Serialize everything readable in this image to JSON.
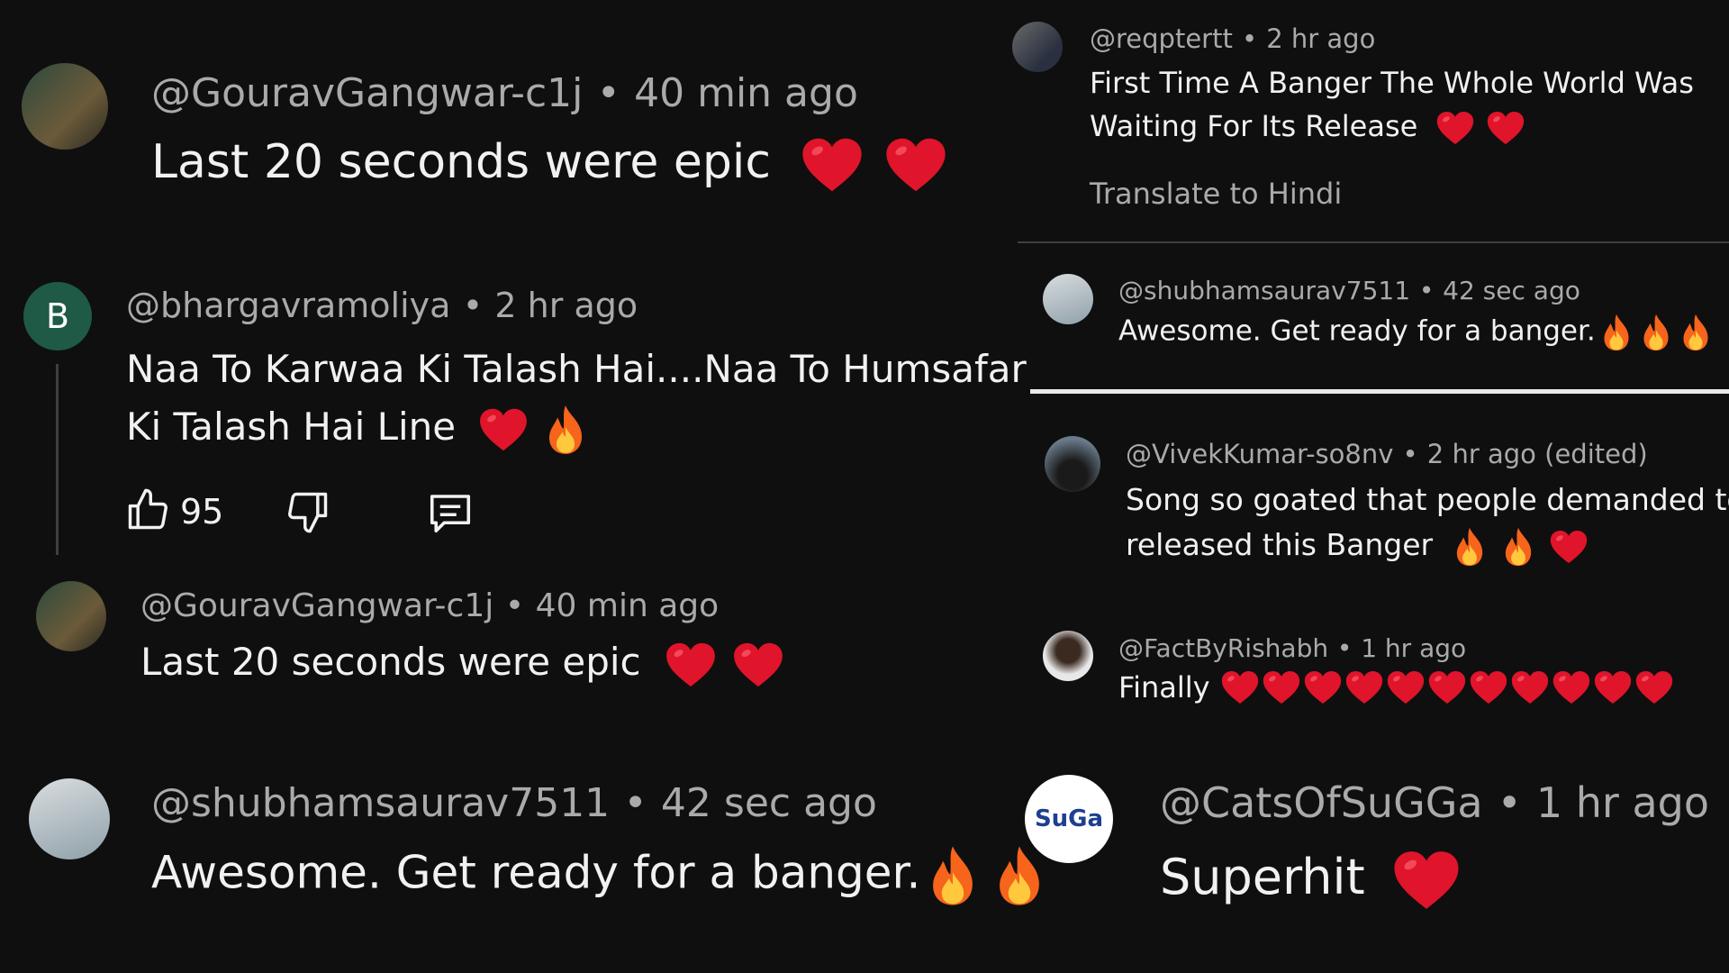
{
  "comments": {
    "c1": {
      "handle": "@GouravGangwar-c1j",
      "time": "40 min ago",
      "text": "Last 20 seconds were epic"
    },
    "c2": {
      "handle": "@bhargavramoliya",
      "time": "2 hr ago",
      "text_line1": "Naa To Karwaa Ki Talash Hai....Naa To Humsafar",
      "text_line2": "Ki Talash Hai Line",
      "avatar_letter": "B",
      "likes": "95"
    },
    "c3": {
      "handle": "@GouravGangwar-c1j",
      "time": "40 min ago",
      "text": "Last 20 seconds were epic"
    },
    "c4": {
      "handle": "@shubhamsaurav7511",
      "time": "42 sec ago",
      "text": "Awesome. Get ready for a banger."
    },
    "c5": {
      "handle": "@reqptertt",
      "time": "2 hr ago",
      "text_line1": "First Time A Banger The Whole World Was",
      "text_line2": "Waiting For Its Release",
      "translate": "Translate to Hindi"
    },
    "c6": {
      "handle": "@shubhamsaurav7511",
      "time": "42 sec ago",
      "text": "Awesome. Get ready for a banger."
    },
    "c7": {
      "handle": "@VivekKumar-so8nv",
      "time": "2 hr ago (edited)",
      "text_line1": "Song so goated that people demanded to",
      "text_line2": "released this Banger"
    },
    "c8": {
      "handle": "@FactByRishabh",
      "time": "1 hr ago",
      "text": "Finally"
    },
    "c9": {
      "handle": "@CatsOfSuGGa",
      "time": "1 hr ago",
      "text": "Superhit",
      "avatar_text": "SuGa"
    }
  },
  "separator": "•",
  "icons": {
    "heart": "red-heart-emoji",
    "fire": "fire-emoji",
    "like": "thumbs-up-icon",
    "dislike": "thumbs-down-icon",
    "reply": "reply-icon"
  },
  "colors": {
    "background": "#0f0f0f",
    "meta": "#aaaaaa",
    "text": "#f1f1f1",
    "heart": "#e0142a",
    "avatar_b": "#1e5a46"
  }
}
